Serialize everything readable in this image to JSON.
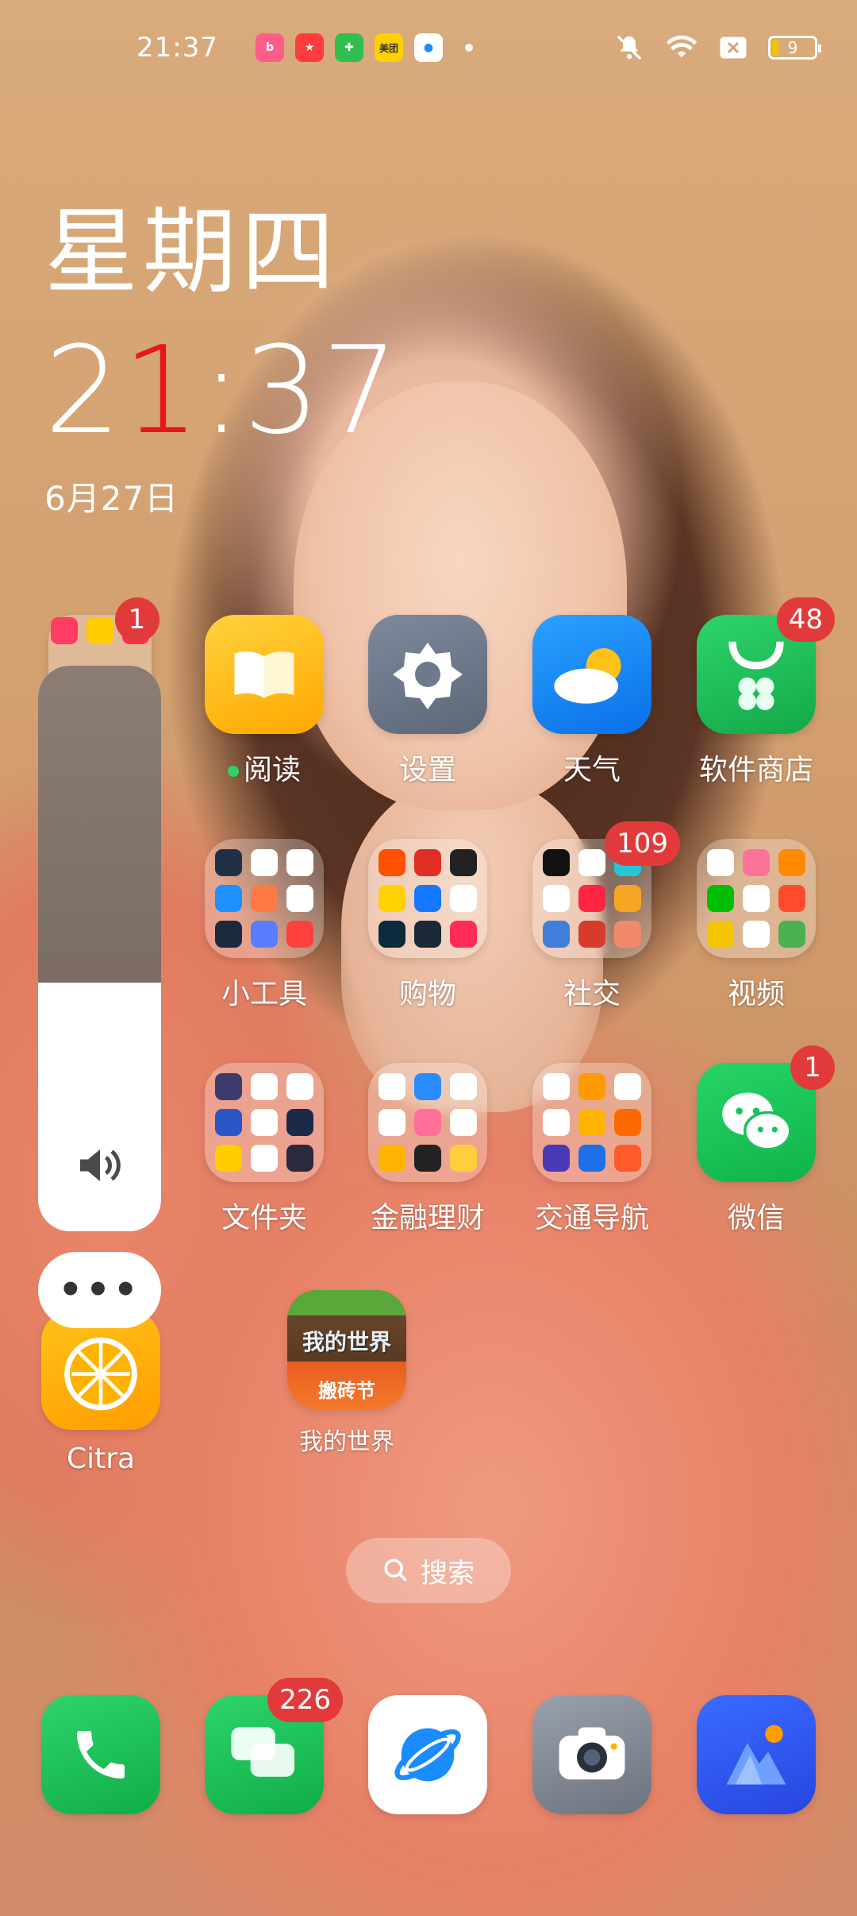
{
  "status_bar": {
    "time": "21:37",
    "notification_apps": [
      "bilibili",
      "fun-app",
      "pinduoduo",
      "meituan",
      "browser"
    ],
    "meituan_text": "美团",
    "battery_level": "9"
  },
  "clock_widget": {
    "weekday": "星期四",
    "time_hour_first": "2",
    "time_hour_second": "1",
    "time_rest": ":37",
    "date": "6月27日"
  },
  "apps": {
    "reading": {
      "label": "阅读",
      "color": "#ffb300"
    },
    "settings": {
      "label": "设置",
      "color": "#6e7a8c"
    },
    "weather": {
      "label": "天气",
      "color": "#1a8cff"
    },
    "app_store": {
      "label": "软件商店",
      "badge": "48",
      "color": "#1fbe5a"
    },
    "tools": {
      "label": "小工具"
    },
    "shopping": {
      "label": "购物"
    },
    "social": {
      "label": "社交",
      "badge": "109"
    },
    "video": {
      "label": "视频"
    },
    "files": {
      "label": "文件夹"
    },
    "finance": {
      "label": "金融理财"
    },
    "transport": {
      "label": "交通导航"
    },
    "wechat": {
      "label": "微信",
      "badge": "1",
      "color": "#17c35a"
    },
    "citra": {
      "label": "Citra"
    },
    "minecraft": {
      "label": "我的世界",
      "title_text": "我的世界",
      "banner_text": "搬砖节"
    },
    "left_folder_badge": "1"
  },
  "volume": {
    "level_percent": 44
  },
  "search": {
    "label": "搜索"
  },
  "dock": {
    "messages_badge": "226",
    "items": [
      "phone",
      "messages",
      "browser",
      "camera",
      "gallery"
    ]
  }
}
